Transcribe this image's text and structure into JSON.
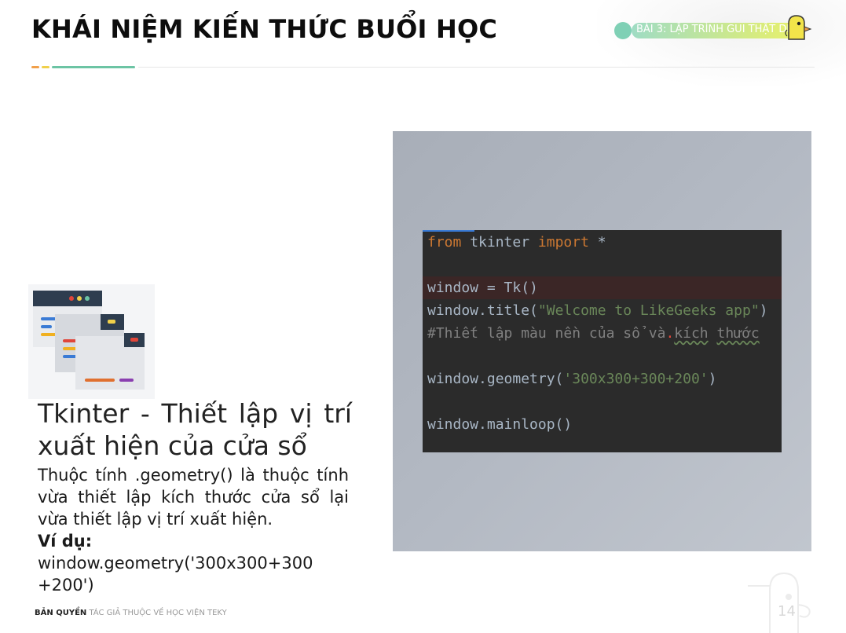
{
  "header": {
    "title": "KHÁI NIỆM KIẾN THỨC BUỔI HỌC",
    "lesson_badge": "BÀI 3: LẬP TRÌNH GUI THẬT DỄ"
  },
  "colors": {
    "accent_green": "#6cc4a4",
    "accent_orange": "#f1a04a",
    "accent_yellow": "#f0d04a",
    "code_background": "#2b2b2b"
  },
  "content": {
    "heading": "Tkinter - Thiết lập vị trí xuất hiện của cửa sổ",
    "description": "Thuộc tính .geometry() là thuộc tính vừa thiết lập kích thước cửa sổ lại vừa thiết lập vị trí xuất hiện.",
    "example_label": "Ví dụ:",
    "example_code": "window.geometry('300x300+300 +200')"
  },
  "code_screenshot": {
    "lines": [
      {
        "kw1": "from",
        "mid": " tkinter ",
        "kw2": "import",
        "rest": " *"
      },
      {
        "text": "window = Tk()"
      },
      {
        "pre": "window.title(",
        "str": "\"Welcome to LikeGeeks app\"",
        "post": ")"
      },
      {
        "comment_a": "#Thiết lập màu nền của sổ và",
        "mark": ".",
        "comment_b": "kích",
        "comment_c": "thước"
      },
      {
        "pre": "window.geometry(",
        "str": "'300x300+300+200'",
        "post": ")"
      },
      {
        "text": "window.mainloop()"
      }
    ]
  },
  "footer": {
    "copyright_bold": "BẢN QUYỀN",
    "copyright_text": "TÁC GIẢ THUỘC VỀ HỌC VIỆN TEKY",
    "page_number": "14"
  },
  "icons": [
    "window-layout-illustration",
    "bird-mascot-icon",
    "teky-watermark-icon"
  ]
}
